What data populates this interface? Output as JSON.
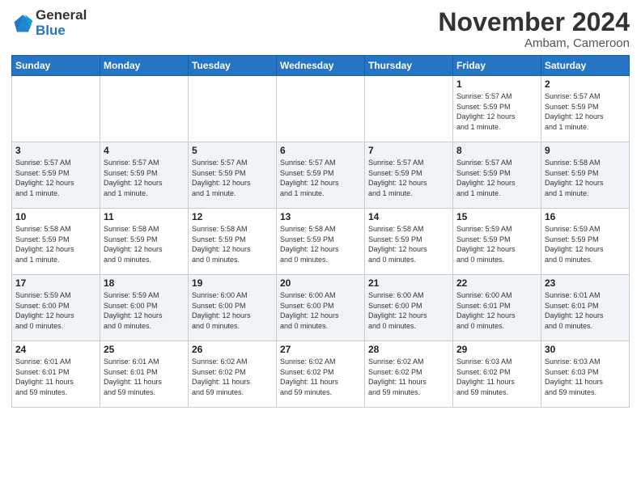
{
  "header": {
    "logo_general": "General",
    "logo_blue": "Blue",
    "month_title": "November 2024",
    "location": "Ambam, Cameroon"
  },
  "days_of_week": [
    "Sunday",
    "Monday",
    "Tuesday",
    "Wednesday",
    "Thursday",
    "Friday",
    "Saturday"
  ],
  "weeks": [
    [
      {
        "day": "",
        "info": ""
      },
      {
        "day": "",
        "info": ""
      },
      {
        "day": "",
        "info": ""
      },
      {
        "day": "",
        "info": ""
      },
      {
        "day": "",
        "info": ""
      },
      {
        "day": "1",
        "info": "Sunrise: 5:57 AM\nSunset: 5:59 PM\nDaylight: 12 hours\nand 1 minute."
      },
      {
        "day": "2",
        "info": "Sunrise: 5:57 AM\nSunset: 5:59 PM\nDaylight: 12 hours\nand 1 minute."
      }
    ],
    [
      {
        "day": "3",
        "info": "Sunrise: 5:57 AM\nSunset: 5:59 PM\nDaylight: 12 hours\nand 1 minute."
      },
      {
        "day": "4",
        "info": "Sunrise: 5:57 AM\nSunset: 5:59 PM\nDaylight: 12 hours\nand 1 minute."
      },
      {
        "day": "5",
        "info": "Sunrise: 5:57 AM\nSunset: 5:59 PM\nDaylight: 12 hours\nand 1 minute."
      },
      {
        "day": "6",
        "info": "Sunrise: 5:57 AM\nSunset: 5:59 PM\nDaylight: 12 hours\nand 1 minute."
      },
      {
        "day": "7",
        "info": "Sunrise: 5:57 AM\nSunset: 5:59 PM\nDaylight: 12 hours\nand 1 minute."
      },
      {
        "day": "8",
        "info": "Sunrise: 5:57 AM\nSunset: 5:59 PM\nDaylight: 12 hours\nand 1 minute."
      },
      {
        "day": "9",
        "info": "Sunrise: 5:58 AM\nSunset: 5:59 PM\nDaylight: 12 hours\nand 1 minute."
      }
    ],
    [
      {
        "day": "10",
        "info": "Sunrise: 5:58 AM\nSunset: 5:59 PM\nDaylight: 12 hours\nand 1 minute."
      },
      {
        "day": "11",
        "info": "Sunrise: 5:58 AM\nSunset: 5:59 PM\nDaylight: 12 hours\nand 0 minutes."
      },
      {
        "day": "12",
        "info": "Sunrise: 5:58 AM\nSunset: 5:59 PM\nDaylight: 12 hours\nand 0 minutes."
      },
      {
        "day": "13",
        "info": "Sunrise: 5:58 AM\nSunset: 5:59 PM\nDaylight: 12 hours\nand 0 minutes."
      },
      {
        "day": "14",
        "info": "Sunrise: 5:58 AM\nSunset: 5:59 PM\nDaylight: 12 hours\nand 0 minutes."
      },
      {
        "day": "15",
        "info": "Sunrise: 5:59 AM\nSunset: 5:59 PM\nDaylight: 12 hours\nand 0 minutes."
      },
      {
        "day": "16",
        "info": "Sunrise: 5:59 AM\nSunset: 5:59 PM\nDaylight: 12 hours\nand 0 minutes."
      }
    ],
    [
      {
        "day": "17",
        "info": "Sunrise: 5:59 AM\nSunset: 6:00 PM\nDaylight: 12 hours\nand 0 minutes."
      },
      {
        "day": "18",
        "info": "Sunrise: 5:59 AM\nSunset: 6:00 PM\nDaylight: 12 hours\nand 0 minutes."
      },
      {
        "day": "19",
        "info": "Sunrise: 6:00 AM\nSunset: 6:00 PM\nDaylight: 12 hours\nand 0 minutes."
      },
      {
        "day": "20",
        "info": "Sunrise: 6:00 AM\nSunset: 6:00 PM\nDaylight: 12 hours\nand 0 minutes."
      },
      {
        "day": "21",
        "info": "Sunrise: 6:00 AM\nSunset: 6:00 PM\nDaylight: 12 hours\nand 0 minutes."
      },
      {
        "day": "22",
        "info": "Sunrise: 6:00 AM\nSunset: 6:01 PM\nDaylight: 12 hours\nand 0 minutes."
      },
      {
        "day": "23",
        "info": "Sunrise: 6:01 AM\nSunset: 6:01 PM\nDaylight: 12 hours\nand 0 minutes."
      }
    ],
    [
      {
        "day": "24",
        "info": "Sunrise: 6:01 AM\nSunset: 6:01 PM\nDaylight: 11 hours\nand 59 minutes."
      },
      {
        "day": "25",
        "info": "Sunrise: 6:01 AM\nSunset: 6:01 PM\nDaylight: 11 hours\nand 59 minutes."
      },
      {
        "day": "26",
        "info": "Sunrise: 6:02 AM\nSunset: 6:02 PM\nDaylight: 11 hours\nand 59 minutes."
      },
      {
        "day": "27",
        "info": "Sunrise: 6:02 AM\nSunset: 6:02 PM\nDaylight: 11 hours\nand 59 minutes."
      },
      {
        "day": "28",
        "info": "Sunrise: 6:02 AM\nSunset: 6:02 PM\nDaylight: 11 hours\nand 59 minutes."
      },
      {
        "day": "29",
        "info": "Sunrise: 6:03 AM\nSunset: 6:02 PM\nDaylight: 11 hours\nand 59 minutes."
      },
      {
        "day": "30",
        "info": "Sunrise: 6:03 AM\nSunset: 6:03 PM\nDaylight: 11 hours\nand 59 minutes."
      }
    ]
  ]
}
